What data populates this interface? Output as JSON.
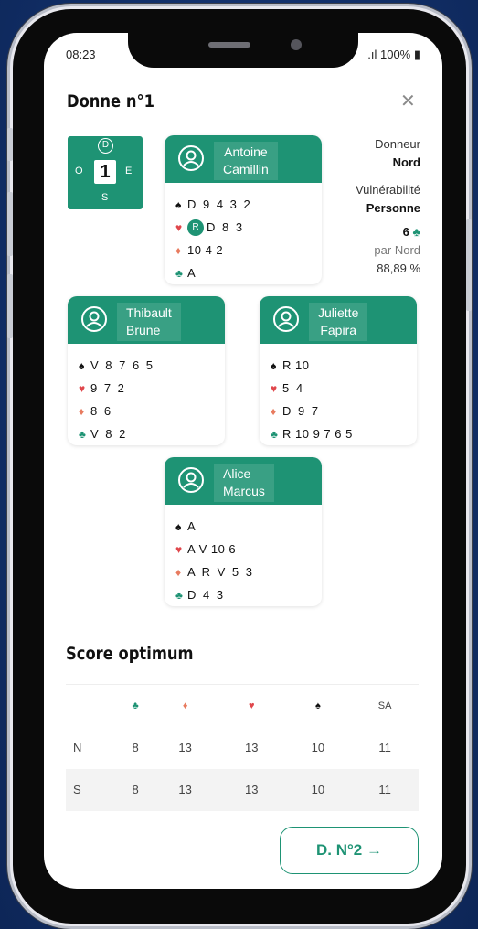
{
  "status": {
    "time": "08:23",
    "battery": "100%"
  },
  "title": "Donne n°1",
  "compass": {
    "dealer_marker": "D",
    "board_number": "1",
    "west": "O",
    "east": "E",
    "south": "S"
  },
  "players": {
    "north": {
      "first": "Antoine",
      "last": "Camillin",
      "spades": "D 9 4 3 2",
      "hearts_badge": "R",
      "hearts": "D 8 3",
      "diamonds": "10 4 2",
      "clubs": "A"
    },
    "west": {
      "first": "Thibault",
      "last": "Brune",
      "spades": "V 8 7 6 5",
      "hearts": "9 7 2",
      "diamonds": "8 6",
      "clubs": "V 8 2"
    },
    "east": {
      "first": "Juliette",
      "last": "Fapira",
      "spades": "R 10",
      "hearts": "5 4",
      "diamonds": "D 9 7",
      "clubs": "R 10 9 7 6 5"
    },
    "south": {
      "first": "Alice",
      "last": "Marcus",
      "spades": "A",
      "hearts": "A V 10 6",
      "diamonds": "A R V 5 3",
      "clubs": "D 4 3"
    }
  },
  "info": {
    "dealer_label": "Donneur",
    "dealer_value": "Nord",
    "vuln_label": "Vulnérabilité",
    "vuln_value": "Personne",
    "contract": "6",
    "contract_by": "par Nord",
    "percent": "88,89 %"
  },
  "score": {
    "title": "Score optimum",
    "headers": [
      "",
      "♣",
      "♦",
      "♥",
      "♠",
      "SA"
    ],
    "rows": [
      {
        "seat": "N",
        "values": [
          "8",
          "13",
          "13",
          "10",
          "11"
        ]
      },
      {
        "seat": "S",
        "values": [
          "8",
          "13",
          "13",
          "10",
          "11"
        ]
      }
    ]
  },
  "next_button": "D. N°2 →",
  "colors": {
    "accent": "#1e9374",
    "hearts": "#e0474c",
    "diamonds": "#e87b5f",
    "background": "#12306a"
  },
  "icons": {
    "close": "close-icon",
    "avatar": "user-circle-icon"
  }
}
